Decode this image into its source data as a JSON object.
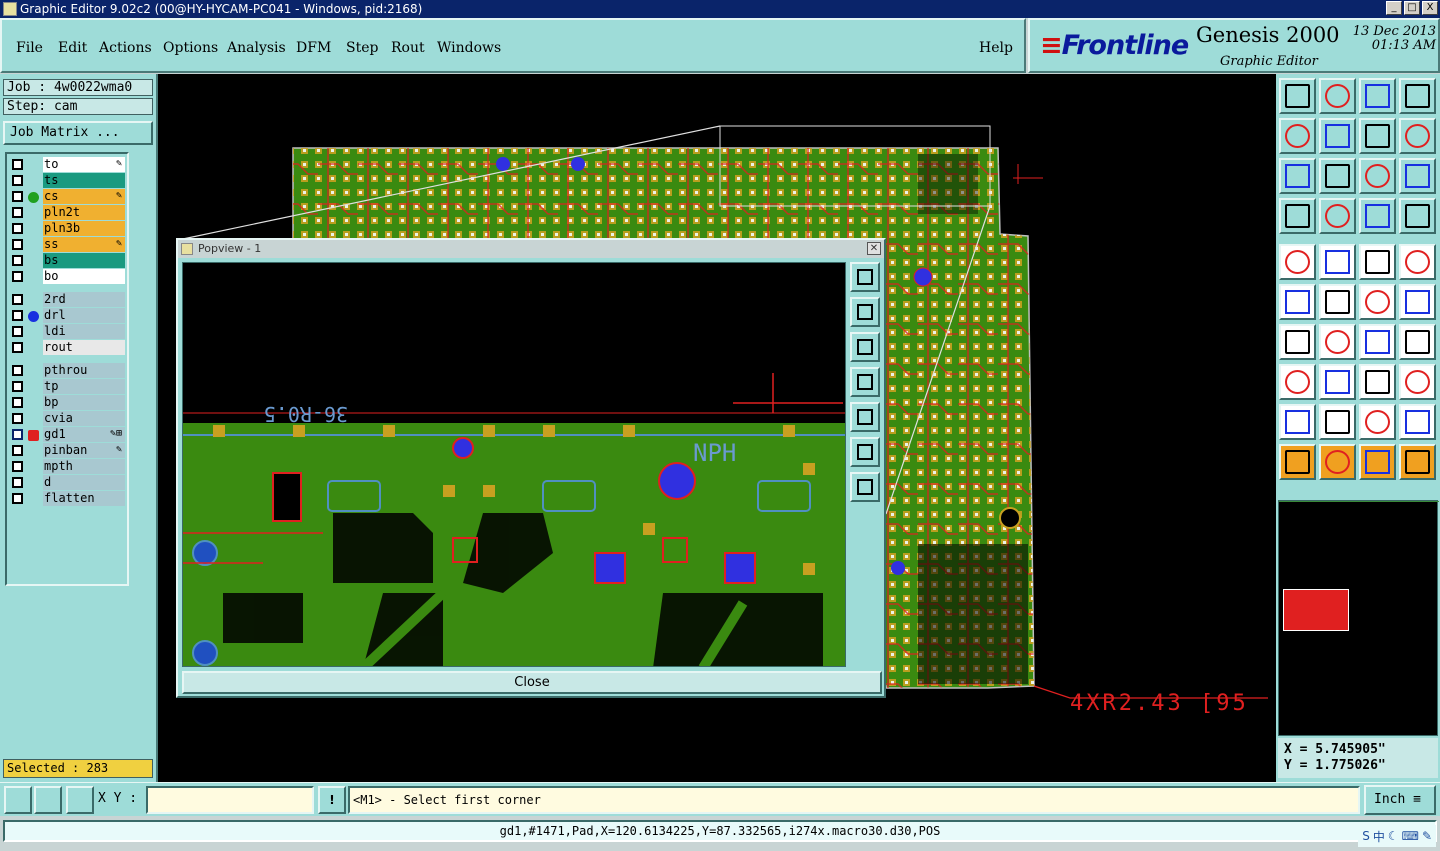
{
  "window": {
    "title": "Graphic Editor 9.02c2 (00@HY-HYCAM-PC041 - Windows, pid:2168)",
    "buttons": [
      "_",
      "□",
      "X"
    ]
  },
  "menu": {
    "items": [
      "File",
      "Edit",
      "Actions",
      "Options",
      "Analysis",
      "DFM",
      "Step",
      "Rout",
      "Windows"
    ],
    "help": "Help"
  },
  "brand": {
    "logo": "Frontline",
    "product": "Genesis 2000",
    "subtitle": "Graphic Editor",
    "date": "13 Dec 2013",
    "time": "01:13 AM"
  },
  "job": {
    "job_label": "Job : 4w0022wma0",
    "step_label": "Step: cam",
    "matrix_button": "Job Matrix ..."
  },
  "layers": [
    {
      "name": "to",
      "bg": "#ffffff",
      "mark": "✎"
    },
    {
      "name": "ts",
      "bg": "#1a9a80",
      "mark": ""
    },
    {
      "name": "cs",
      "bg": "#f0b030",
      "mark": "✎",
      "dot": "#20a020"
    },
    {
      "name": "pln2t",
      "bg": "#f0b030",
      "mark": ""
    },
    {
      "name": "pln3b",
      "bg": "#f0b030",
      "mark": ""
    },
    {
      "name": "ss",
      "bg": "#f0b030",
      "mark": "✎"
    },
    {
      "name": "bs",
      "bg": "#1a9a80",
      "mark": ""
    },
    {
      "name": "bo",
      "bg": "#ffffff",
      "mark": ""
    },
    {
      "name": "2rd",
      "bg": "#a8c8d0",
      "mark": ""
    },
    {
      "name": "drl",
      "bg": "#a8c8d0",
      "mark": "",
      "dot": "#1830e0"
    },
    {
      "name": "ldi",
      "bg": "#a8c8d0",
      "mark": ""
    },
    {
      "name": "rout",
      "bg": "#e8e8e8",
      "mark": ""
    },
    {
      "name": "pthrou",
      "bg": "#a8c8d0",
      "mark": ""
    },
    {
      "name": "tp",
      "bg": "#a8c8d0",
      "mark": ""
    },
    {
      "name": "bp",
      "bg": "#a8c8d0",
      "mark": ""
    },
    {
      "name": "cvia",
      "bg": "#a8c8d0",
      "mark": ""
    },
    {
      "name": "gd1",
      "bg": "#a8c8d0",
      "mark": "✎⊞",
      "active": true
    },
    {
      "name": "pinban",
      "bg": "#a8c8d0",
      "mark": "✎"
    },
    {
      "name": "mpth",
      "bg": "#a8c8d0",
      "mark": ""
    },
    {
      "name": "d",
      "bg": "#a8c8d0",
      "mark": ""
    },
    {
      "name": "flatten",
      "bg": "#a8c8d0",
      "mark": ""
    }
  ],
  "selected": "Selected : 283",
  "popview": {
    "title": "Popview - 1",
    "close_label": "Close"
  },
  "canvas_labels": {
    "dimension": "4XR2.43 [95",
    "popview_top": "36-R0.5",
    "popview_id": "NPH"
  },
  "coords": {
    "x": "X = 5.745905\"",
    "y": "Y = 1.775026\""
  },
  "cmd": {
    "xy_label": "X Y :",
    "xy_value": "",
    "prompt": "<M1> - Select first corner",
    "units": "Inch"
  },
  "status": "gd1,#1471,Pad,X=120.6134225,Y=87.332565,i274x.macro30.d30,POS",
  "colors": {
    "board": "#3a8a10",
    "pad": "#c8a020",
    "trace": "#e02020",
    "via": "#2020e0",
    "panel": "#9edcd8"
  }
}
